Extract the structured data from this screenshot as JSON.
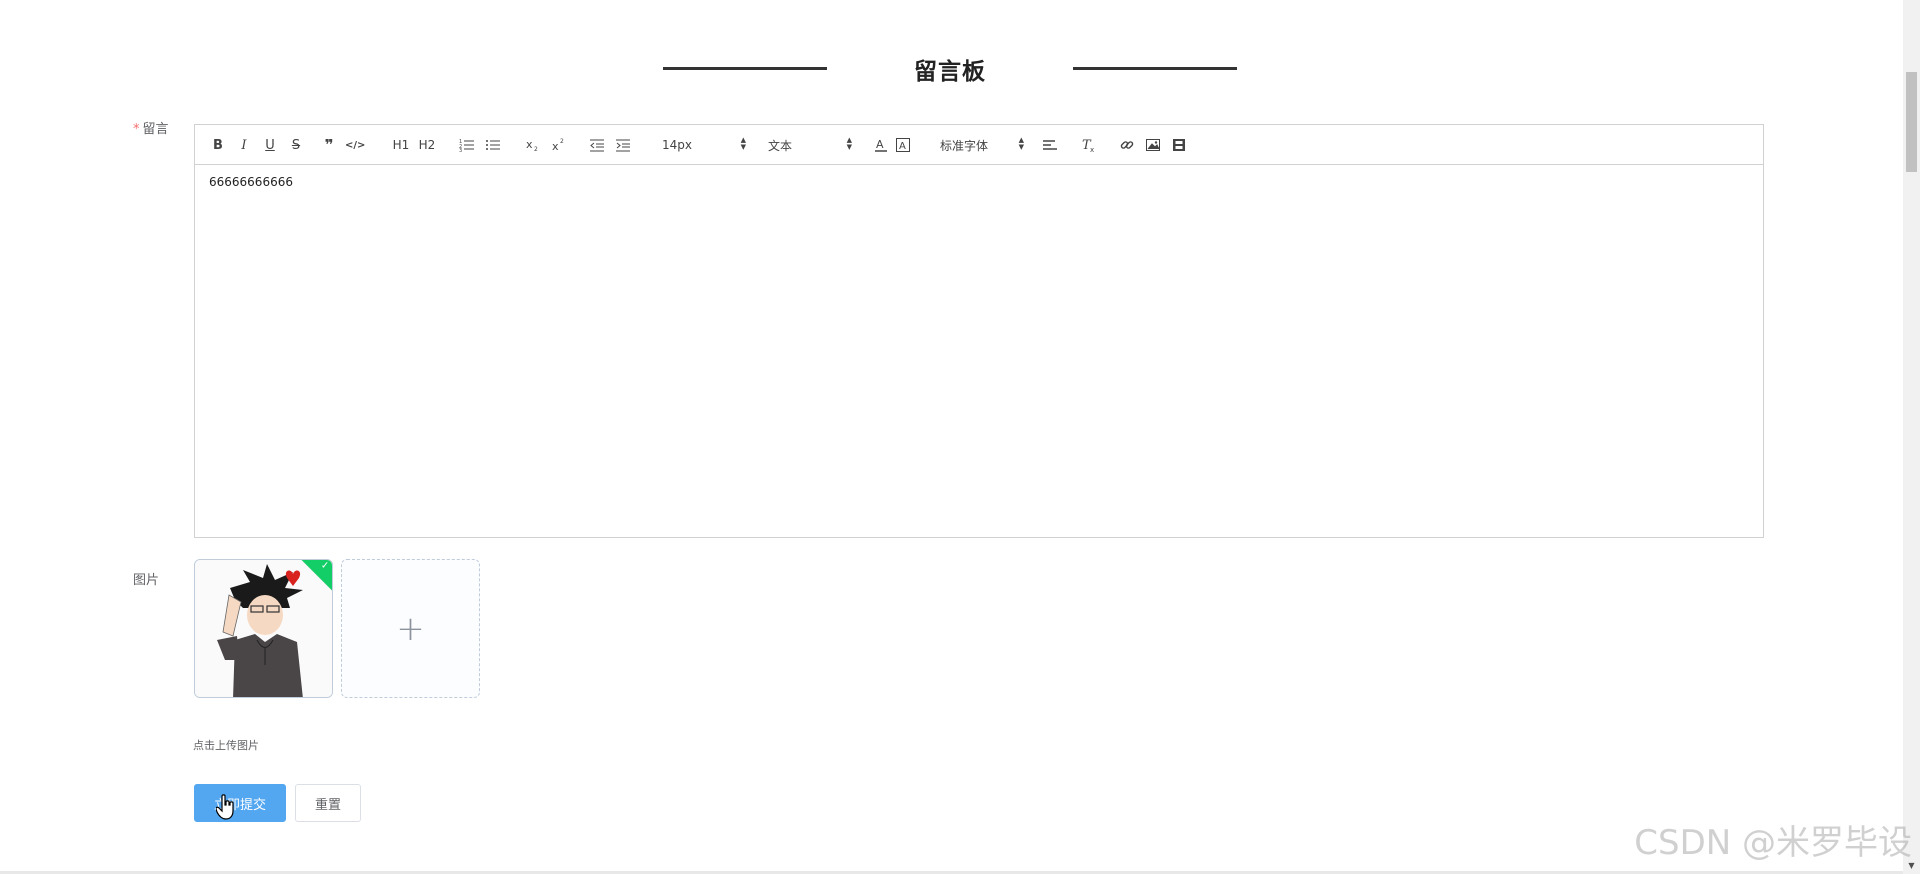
{
  "page": {
    "title": "留言板"
  },
  "form": {
    "message_label": "留言",
    "required_mark": "*",
    "image_label": "图片"
  },
  "editor": {
    "toolbar": {
      "bold": "B",
      "italic": "I",
      "underline": "U",
      "strike": "S",
      "blockquote": "❞",
      "code": "</>",
      "h1": "H1",
      "h2": "H2",
      "size_select": "14px",
      "header_select": "文本",
      "font_select": "标准字体"
    },
    "content": "66666666666"
  },
  "upload": {
    "plus": "+",
    "tip": "点击上传图片",
    "uploaded_count": 1
  },
  "buttons": {
    "submit": "立即提交",
    "reset": "重置"
  },
  "watermark": "CSDN @米罗毕设",
  "colors": {
    "primary": "#53a6f0",
    "success": "#13ce66",
    "required": "#f56c6c"
  }
}
